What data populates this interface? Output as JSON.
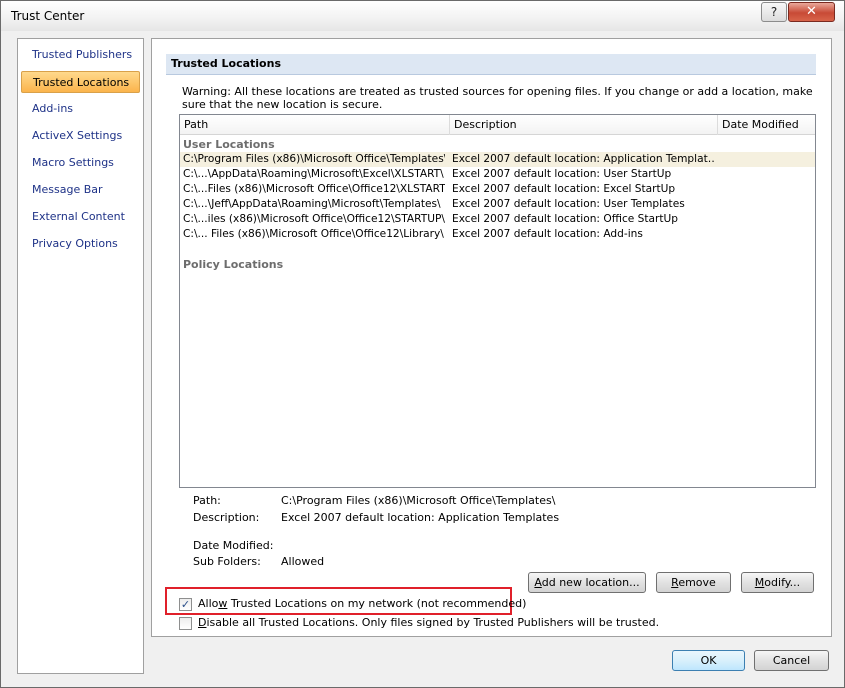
{
  "window": {
    "title": "Trust Center",
    "help_label": "?",
    "close_label": "✕"
  },
  "sidebar": {
    "items": [
      {
        "label": "Trusted Publishers"
      },
      {
        "label": "Trusted Locations"
      },
      {
        "label": "Add-ins"
      },
      {
        "label": "ActiveX Settings"
      },
      {
        "label": "Macro Settings"
      },
      {
        "label": "Message Bar"
      },
      {
        "label": "External Content"
      },
      {
        "label": "Privacy Options"
      }
    ],
    "selected_index": 1
  },
  "main": {
    "section_title": "Trusted Locations",
    "warning": "Warning: All these locations are treated as trusted sources for opening files.  If you change or add a location, make sure that the new location is secure.",
    "columns": [
      "Path",
      "Description",
      "Date Modified"
    ],
    "user_group_label": "User Locations",
    "policy_group_label": "Policy Locations",
    "rows": [
      {
        "path": "C:\\Program Files (x86)\\Microsoft Office\\Templates\\",
        "description": "Excel 2007 default location: Application Templat…",
        "date": ""
      },
      {
        "path": "C:\\...\\AppData\\Roaming\\Microsoft\\Excel\\XLSTART\\",
        "description": "Excel 2007 default location: User StartUp",
        "date": ""
      },
      {
        "path": "C:\\...Files (x86)\\Microsoft Office\\Office12\\XLSTART\\",
        "description": "Excel 2007 default location: Excel StartUp",
        "date": ""
      },
      {
        "path": "C:\\...\\Jeff\\AppData\\Roaming\\Microsoft\\Templates\\",
        "description": "Excel 2007 default location: User Templates",
        "date": ""
      },
      {
        "path": "C:\\...iles (x86)\\Microsoft Office\\Office12\\STARTUP\\",
        "description": "Excel 2007 default location: Office StartUp",
        "date": ""
      },
      {
        "path": "C:\\... Files (x86)\\Microsoft Office\\Office12\\Library\\",
        "description": "Excel 2007 default location: Add-ins",
        "date": ""
      }
    ],
    "selected_row": 0,
    "details": {
      "path_label": "Path:",
      "path_value": "C:\\Program Files (x86)\\Microsoft Office\\Templates\\",
      "description_label": "Description:",
      "description_value": "Excel 2007 default location: Application Templates",
      "date_modified_label": "Date Modified:",
      "date_modified_value": "",
      "sub_folders_label": "Sub Folders:",
      "sub_folders_value": "Allowed"
    },
    "buttons": {
      "add_new_pre": "",
      "add_new_u": "A",
      "add_new_post": "dd new location...",
      "remove_pre": "",
      "remove_u": "R",
      "remove_post": "emove",
      "modify_pre": "",
      "modify_u": "M",
      "modify_post": "odify..."
    },
    "allow_network": {
      "label_pre": "Allo",
      "label_u": "w",
      "label_post": " Trusted Locations on my network (not recommended)",
      "checked": true,
      "check_glyph": "✓"
    },
    "disable_all": {
      "label_pre": "",
      "label_u": "D",
      "label_post": "isable all Trusted Locations. Only files signed by Trusted Publishers will be trusted.",
      "checked": false,
      "check_glyph": ""
    }
  },
  "footer": {
    "ok_label": "OK",
    "cancel_label": "Cancel"
  },
  "colors": {
    "selected_nav": "#fbb44c",
    "highlight_box": "#e0202a",
    "link_text": "#1e3287",
    "section_header_bg": "#dde7f3"
  }
}
